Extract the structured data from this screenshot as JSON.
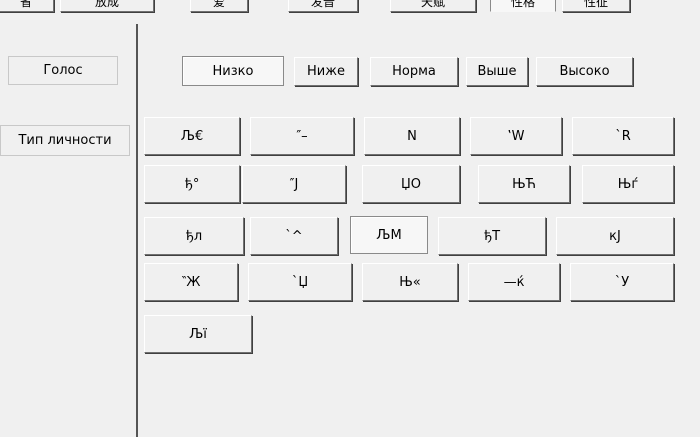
{
  "tabs": [
    {
      "label": "省"
    },
    {
      "label": "放成"
    },
    {
      "label": "爱"
    },
    {
      "label": "发音"
    },
    {
      "label": "天赋"
    },
    {
      "label": "性格"
    },
    {
      "label": "性征"
    }
  ],
  "sidebar": {
    "voice_label": "Голос",
    "personality_label": "Тип личности"
  },
  "pitch": {
    "selected": "Низко",
    "options": [
      "Низко",
      "Ниже",
      "Норма",
      "Выше",
      "Высоко"
    ]
  },
  "personality_grid": {
    "rows": [
      [
        "Љ€",
        "″–",
        "N",
        "‛W",
        "`R"
      ],
      [
        "ђ°",
        "″Ј",
        "ЏО",
        "ЊЋ",
        "Њѓ"
      ],
      [
        "ђл",
        "`^",
        "ЉМ",
        "ђТ",
        "кЈ"
      ],
      [
        "‶Ж",
        "`Џ",
        "Њ«",
        "—ќ",
        "`У"
      ],
      [
        "Љї"
      ]
    ],
    "selected": "ЉМ"
  }
}
